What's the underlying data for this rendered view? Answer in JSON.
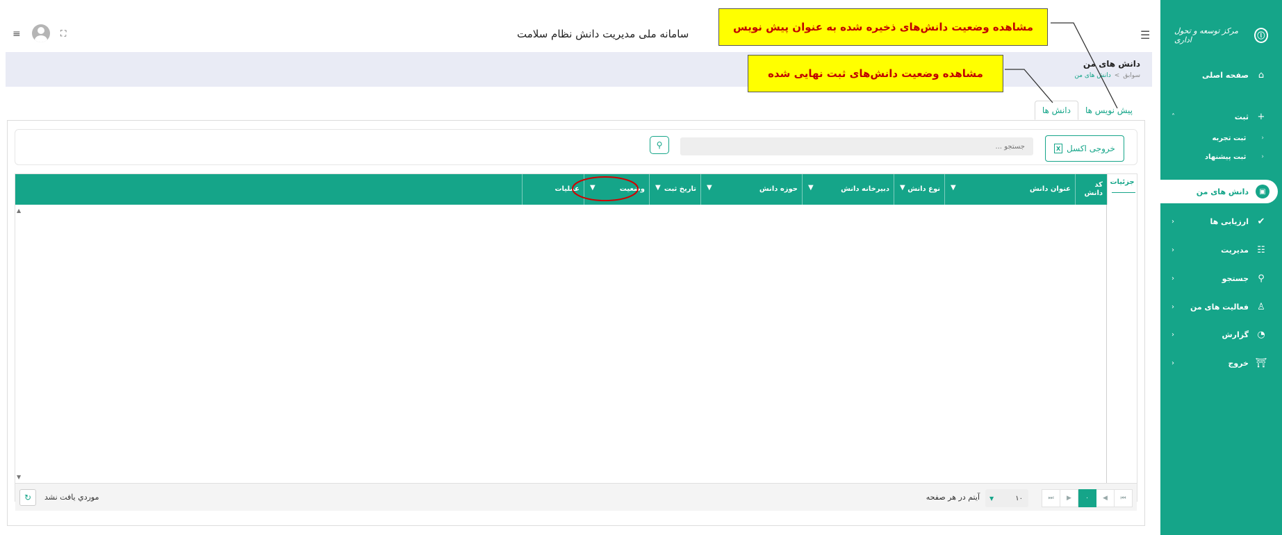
{
  "header": {
    "title": "سامانه ملی مدیریت دانش نظام سلامت",
    "menu_icon": "hamburger-icon",
    "fullscreen_icon": "expand-icon"
  },
  "sidebar": {
    "logo_text": "مرکز توسعه و تحول اداری",
    "items": [
      {
        "label": "صفحه اصلی",
        "icon": "home-icon"
      },
      {
        "label": "ثبت",
        "icon": "plus-icon"
      },
      {
        "label": "دانش های من",
        "icon": "inbox-icon"
      },
      {
        "label": "ارزیابی ها",
        "icon": "check-icon"
      },
      {
        "label": "مدیریت",
        "icon": "list-icon"
      },
      {
        "label": "جستجو",
        "icon": "search-icon"
      },
      {
        "label": "فعالیت های من",
        "icon": "user-icon"
      },
      {
        "label": "گزارش",
        "icon": "pie-icon"
      },
      {
        "label": "خروج",
        "icon": "exit-icon"
      }
    ],
    "sub_items": [
      {
        "label": "ثبت تجربه"
      },
      {
        "label": "ثبت پیشنهاد"
      }
    ]
  },
  "page": {
    "title": "دانش های من",
    "breadcrumb": {
      "root": "سوابق",
      "sep": ">",
      "current": "دانش های من"
    }
  },
  "tabs": [
    {
      "label": "پیش نویس ها"
    },
    {
      "label": "دانش ها"
    }
  ],
  "toolbar": {
    "excel_label": "خروجی اکسل",
    "search_placeholder": "جستجو ..."
  },
  "grid": {
    "details_header": "جزئیات",
    "columns": [
      {
        "label": "کد دانش"
      },
      {
        "label": "عنوان دانش"
      },
      {
        "label": "نوع دانش"
      },
      {
        "label": "دبیرخانه دانش"
      },
      {
        "label": "حوزه دانش"
      },
      {
        "label": "تاریخ ثبت"
      },
      {
        "label": "وضعیت"
      },
      {
        "label": "عملیات"
      }
    ],
    "empty_message": "موردي يافت نشد",
    "page_size": "۱۰",
    "per_page_label": "آیتم در هر صفحه",
    "current_page": "۰"
  },
  "annotations": {
    "drafts": "مشاهده وضعیت دانش‌های ذخیره شده به عنوان پیش نویس",
    "final": "مشاهده وضعیت دانش‌های ثبت نهایی شده"
  },
  "colors": {
    "primary": "#15a589",
    "callout_bg": "#ffff00",
    "callout_text": "#c00000",
    "highlight_ellipse": "#d00000"
  }
}
